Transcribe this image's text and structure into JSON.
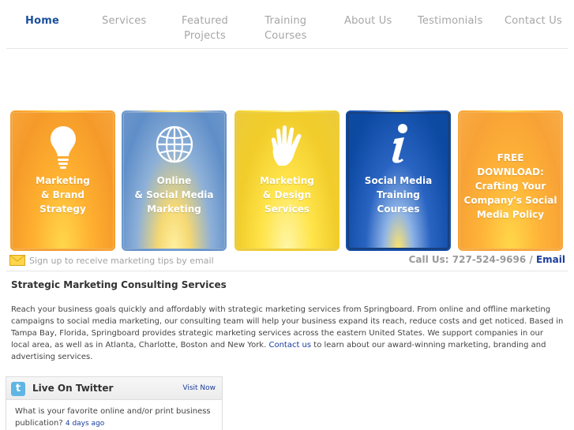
{
  "nav": {
    "items": [
      {
        "label": "Home",
        "active": true
      },
      {
        "label": "Services"
      },
      {
        "label": "Featured",
        "label2": "Projects"
      },
      {
        "label": "Training",
        "label2": "Courses"
      },
      {
        "label": "About Us"
      },
      {
        "label": "Testimonials"
      },
      {
        "label": "Contact Us"
      }
    ]
  },
  "tiles": [
    {
      "lines": [
        "Marketing",
        "& Brand",
        "Strategy"
      ],
      "icon": "lightbulb-icon"
    },
    {
      "lines": [
        "Online",
        "& Social Media",
        "Marketing"
      ],
      "icon": "globe-icon"
    },
    {
      "lines": [
        "Marketing",
        "& Design",
        "Services"
      ],
      "icon": "hand-icon"
    },
    {
      "lines": [
        "Social Media Training",
        "Courses"
      ],
      "icon": "info-icon"
    },
    {
      "lines": [
        "FREE",
        "DOWNLOAD:",
        "Crafting Your",
        "Company's Social",
        "Media Policy"
      ]
    }
  ],
  "signup": {
    "text": "Sign up to receive marketing tips by email",
    "icon": "envelope-icon"
  },
  "callus": {
    "text": "Call Us: 727-524-9696 / ",
    "email": "Email"
  },
  "heading": "Strategic Marketing Consulting Services",
  "body": {
    "part1": "Reach your business goals quickly and affordably with strategic marketing services from Springboard. From online and offline marketing campaigns to social media marketing, our consulting team will help your business expand its reach, reduce costs and get noticed. Based in Tampa Bay, Florida, Springboard provides strategic marketing services across the eastern United States. We support companies in our local area, as well as in Atlanta, Charlotte, Boston and New York. ",
    "link": "Contact us",
    "part2": " to learn about our award-winning marketing, branding and advertising services."
  },
  "twitter": {
    "title": "Live On Twitter",
    "visit": "Visit Now",
    "tweet": "What is your favorite online and/or print business publication? ",
    "when": "4 days ago",
    "logo_letter": "t"
  },
  "colors": {
    "nav_active": "#1a4f9c",
    "link": "#1a3d9c",
    "tile_orange": "#f59a2a",
    "tile_blue": "#0c4aa3",
    "tile_yellow": "#f1cc2a"
  }
}
